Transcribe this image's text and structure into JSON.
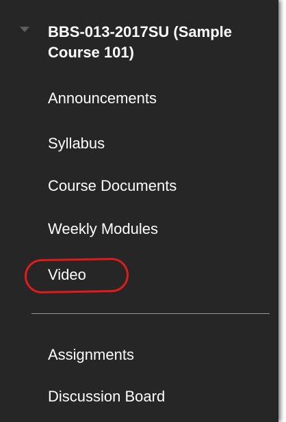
{
  "course": {
    "title": "BBS-013-2017SU (Sample\nCourse 101)",
    "expand_icon": "caret-down-icon"
  },
  "menu": {
    "items": [
      {
        "label": "Announcements"
      },
      {
        "label": "Syllabus"
      },
      {
        "label": "Course Documents"
      },
      {
        "label": "Weekly Modules"
      },
      {
        "label": "Video"
      }
    ],
    "items_after_divider": [
      {
        "label": "Assignments"
      },
      {
        "label": "Discussion Board"
      }
    ]
  },
  "colors": {
    "panel_bg": "#262626",
    "text": "#ffffff",
    "highlight": "#e11a1a",
    "divider": "#9a9a9a"
  }
}
